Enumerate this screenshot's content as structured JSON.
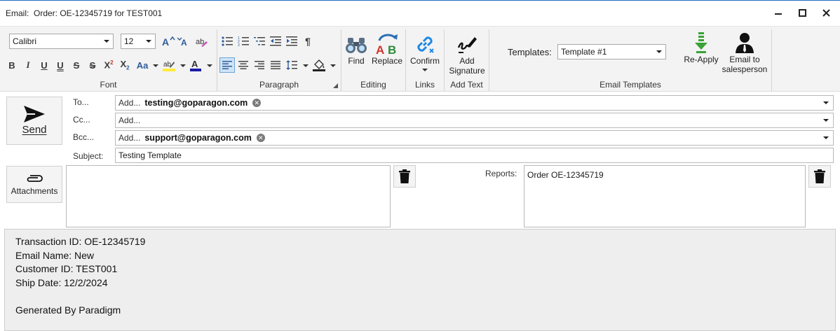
{
  "window": {
    "title": "Email:  Order: OE-12345719 for TEST001"
  },
  "ribbon": {
    "font": {
      "family": "Calibri",
      "size": "12",
      "label": "Font"
    },
    "paragraph": {
      "label": "Paragraph"
    },
    "editing": {
      "label": "Editing",
      "find": "Find",
      "replace": "Replace"
    },
    "links": {
      "label": "Links",
      "confirm": "Confirm"
    },
    "add_text": {
      "label": "Add Text",
      "add_signature_line1": "Add",
      "add_signature_line2": "Signature"
    },
    "email_templates": {
      "label": "Email Templates",
      "templates_label": "Templates:",
      "selected_template": "Template #1",
      "reapply": "Re-Apply",
      "email_to_line1": "Email to",
      "email_to_line2": "salesperson"
    }
  },
  "compose": {
    "send": "Send",
    "attachments": "Attachments",
    "to_label": "To...",
    "cc_label": "Cc...",
    "bcc_label": "Bcc...",
    "subject_label": "Subject:",
    "add_placeholder": "Add...",
    "to_recipients": [
      "testing@goparagon.com"
    ],
    "bcc_recipients": [
      "support@goparagon.com"
    ],
    "subject": "Testing Template",
    "reports_label": "Reports:",
    "reports": [
      "Order OE-12345719"
    ]
  },
  "body": {
    "lines": [
      "Transaction ID: OE-12345719",
      "Email Name: New",
      "Customer ID: TEST001",
      "Ship Date: 12/2/2024",
      "",
      "Generated By Paradigm"
    ]
  },
  "colors": {
    "accent": "#1f6fbf",
    "reapply_icon": "#3aa335",
    "link_icon": "#1e88e5",
    "selected_button": "#cfe3f7"
  }
}
